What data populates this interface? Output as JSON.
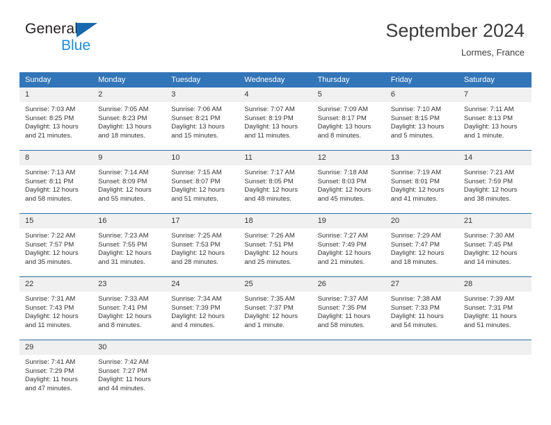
{
  "brand": {
    "name_top": "General",
    "name_bottom": "Blue",
    "triangle_color": "#1769b0",
    "blue_color": "#1e8cdb"
  },
  "header": {
    "title": "September 2024",
    "subtitle": "Lormes, France"
  },
  "theme": {
    "header_bg": "#3275b8",
    "row_divider": "#2e6da4",
    "daynum_bg": "#f0f0f0",
    "text": "#333333"
  },
  "weekdays": [
    "Sunday",
    "Monday",
    "Tuesday",
    "Wednesday",
    "Thursday",
    "Friday",
    "Saturday"
  ],
  "labels": {
    "sunrise": "Sunrise:",
    "sunset": "Sunset:",
    "daylight": "Daylight:"
  },
  "weeks": [
    [
      {
        "day": "1",
        "sunrise": "Sunrise: 7:03 AM",
        "sunset": "Sunset: 8:25 PM",
        "daylight_l1": "Daylight: 13 hours",
        "daylight_l2": "and 21 minutes."
      },
      {
        "day": "2",
        "sunrise": "Sunrise: 7:05 AM",
        "sunset": "Sunset: 8:23 PM",
        "daylight_l1": "Daylight: 13 hours",
        "daylight_l2": "and 18 minutes."
      },
      {
        "day": "3",
        "sunrise": "Sunrise: 7:06 AM",
        "sunset": "Sunset: 8:21 PM",
        "daylight_l1": "Daylight: 13 hours",
        "daylight_l2": "and 15 minutes."
      },
      {
        "day": "4",
        "sunrise": "Sunrise: 7:07 AM",
        "sunset": "Sunset: 8:19 PM",
        "daylight_l1": "Daylight: 13 hours",
        "daylight_l2": "and 11 minutes."
      },
      {
        "day": "5",
        "sunrise": "Sunrise: 7:09 AM",
        "sunset": "Sunset: 8:17 PM",
        "daylight_l1": "Daylight: 13 hours",
        "daylight_l2": "and 8 minutes."
      },
      {
        "day": "6",
        "sunrise": "Sunrise: 7:10 AM",
        "sunset": "Sunset: 8:15 PM",
        "daylight_l1": "Daylight: 13 hours",
        "daylight_l2": "and 5 minutes."
      },
      {
        "day": "7",
        "sunrise": "Sunrise: 7:11 AM",
        "sunset": "Sunset: 8:13 PM",
        "daylight_l1": "Daylight: 13 hours",
        "daylight_l2": "and 1 minute."
      }
    ],
    [
      {
        "day": "8",
        "sunrise": "Sunrise: 7:13 AM",
        "sunset": "Sunset: 8:11 PM",
        "daylight_l1": "Daylight: 12 hours",
        "daylight_l2": "and 58 minutes."
      },
      {
        "day": "9",
        "sunrise": "Sunrise: 7:14 AM",
        "sunset": "Sunset: 8:09 PM",
        "daylight_l1": "Daylight: 12 hours",
        "daylight_l2": "and 55 minutes."
      },
      {
        "day": "10",
        "sunrise": "Sunrise: 7:15 AM",
        "sunset": "Sunset: 8:07 PM",
        "daylight_l1": "Daylight: 12 hours",
        "daylight_l2": "and 51 minutes."
      },
      {
        "day": "11",
        "sunrise": "Sunrise: 7:17 AM",
        "sunset": "Sunset: 8:05 PM",
        "daylight_l1": "Daylight: 12 hours",
        "daylight_l2": "and 48 minutes."
      },
      {
        "day": "12",
        "sunrise": "Sunrise: 7:18 AM",
        "sunset": "Sunset: 8:03 PM",
        "daylight_l1": "Daylight: 12 hours",
        "daylight_l2": "and 45 minutes."
      },
      {
        "day": "13",
        "sunrise": "Sunrise: 7:19 AM",
        "sunset": "Sunset: 8:01 PM",
        "daylight_l1": "Daylight: 12 hours",
        "daylight_l2": "and 41 minutes."
      },
      {
        "day": "14",
        "sunrise": "Sunrise: 7:21 AM",
        "sunset": "Sunset: 7:59 PM",
        "daylight_l1": "Daylight: 12 hours",
        "daylight_l2": "and 38 minutes."
      }
    ],
    [
      {
        "day": "15",
        "sunrise": "Sunrise: 7:22 AM",
        "sunset": "Sunset: 7:57 PM",
        "daylight_l1": "Daylight: 12 hours",
        "daylight_l2": "and 35 minutes."
      },
      {
        "day": "16",
        "sunrise": "Sunrise: 7:23 AM",
        "sunset": "Sunset: 7:55 PM",
        "daylight_l1": "Daylight: 12 hours",
        "daylight_l2": "and 31 minutes."
      },
      {
        "day": "17",
        "sunrise": "Sunrise: 7:25 AM",
        "sunset": "Sunset: 7:53 PM",
        "daylight_l1": "Daylight: 12 hours",
        "daylight_l2": "and 28 minutes."
      },
      {
        "day": "18",
        "sunrise": "Sunrise: 7:26 AM",
        "sunset": "Sunset: 7:51 PM",
        "daylight_l1": "Daylight: 12 hours",
        "daylight_l2": "and 25 minutes."
      },
      {
        "day": "19",
        "sunrise": "Sunrise: 7:27 AM",
        "sunset": "Sunset: 7:49 PM",
        "daylight_l1": "Daylight: 12 hours",
        "daylight_l2": "and 21 minutes."
      },
      {
        "day": "20",
        "sunrise": "Sunrise: 7:29 AM",
        "sunset": "Sunset: 7:47 PM",
        "daylight_l1": "Daylight: 12 hours",
        "daylight_l2": "and 18 minutes."
      },
      {
        "day": "21",
        "sunrise": "Sunrise: 7:30 AM",
        "sunset": "Sunset: 7:45 PM",
        "daylight_l1": "Daylight: 12 hours",
        "daylight_l2": "and 14 minutes."
      }
    ],
    [
      {
        "day": "22",
        "sunrise": "Sunrise: 7:31 AM",
        "sunset": "Sunset: 7:43 PM",
        "daylight_l1": "Daylight: 12 hours",
        "daylight_l2": "and 11 minutes."
      },
      {
        "day": "23",
        "sunrise": "Sunrise: 7:33 AM",
        "sunset": "Sunset: 7:41 PM",
        "daylight_l1": "Daylight: 12 hours",
        "daylight_l2": "and 8 minutes."
      },
      {
        "day": "24",
        "sunrise": "Sunrise: 7:34 AM",
        "sunset": "Sunset: 7:39 PM",
        "daylight_l1": "Daylight: 12 hours",
        "daylight_l2": "and 4 minutes."
      },
      {
        "day": "25",
        "sunrise": "Sunrise: 7:35 AM",
        "sunset": "Sunset: 7:37 PM",
        "daylight_l1": "Daylight: 12 hours",
        "daylight_l2": "and 1 minute."
      },
      {
        "day": "26",
        "sunrise": "Sunrise: 7:37 AM",
        "sunset": "Sunset: 7:35 PM",
        "daylight_l1": "Daylight: 11 hours",
        "daylight_l2": "and 58 minutes."
      },
      {
        "day": "27",
        "sunrise": "Sunrise: 7:38 AM",
        "sunset": "Sunset: 7:33 PM",
        "daylight_l1": "Daylight: 11 hours",
        "daylight_l2": "and 54 minutes."
      },
      {
        "day": "28",
        "sunrise": "Sunrise: 7:39 AM",
        "sunset": "Sunset: 7:31 PM",
        "daylight_l1": "Daylight: 11 hours",
        "daylight_l2": "and 51 minutes."
      }
    ],
    [
      {
        "day": "29",
        "sunrise": "Sunrise: 7:41 AM",
        "sunset": "Sunset: 7:29 PM",
        "daylight_l1": "Daylight: 11 hours",
        "daylight_l2": "and 47 minutes."
      },
      {
        "day": "30",
        "sunrise": "Sunrise: 7:42 AM",
        "sunset": "Sunset: 7:27 PM",
        "daylight_l1": "Daylight: 11 hours",
        "daylight_l2": "and 44 minutes."
      },
      {
        "day": "",
        "sunrise": "",
        "sunset": "",
        "daylight_l1": "",
        "daylight_l2": ""
      },
      {
        "day": "",
        "sunrise": "",
        "sunset": "",
        "daylight_l1": "",
        "daylight_l2": ""
      },
      {
        "day": "",
        "sunrise": "",
        "sunset": "",
        "daylight_l1": "",
        "daylight_l2": ""
      },
      {
        "day": "",
        "sunrise": "",
        "sunset": "",
        "daylight_l1": "",
        "daylight_l2": ""
      },
      {
        "day": "",
        "sunrise": "",
        "sunset": "",
        "daylight_l1": "",
        "daylight_l2": ""
      }
    ]
  ]
}
